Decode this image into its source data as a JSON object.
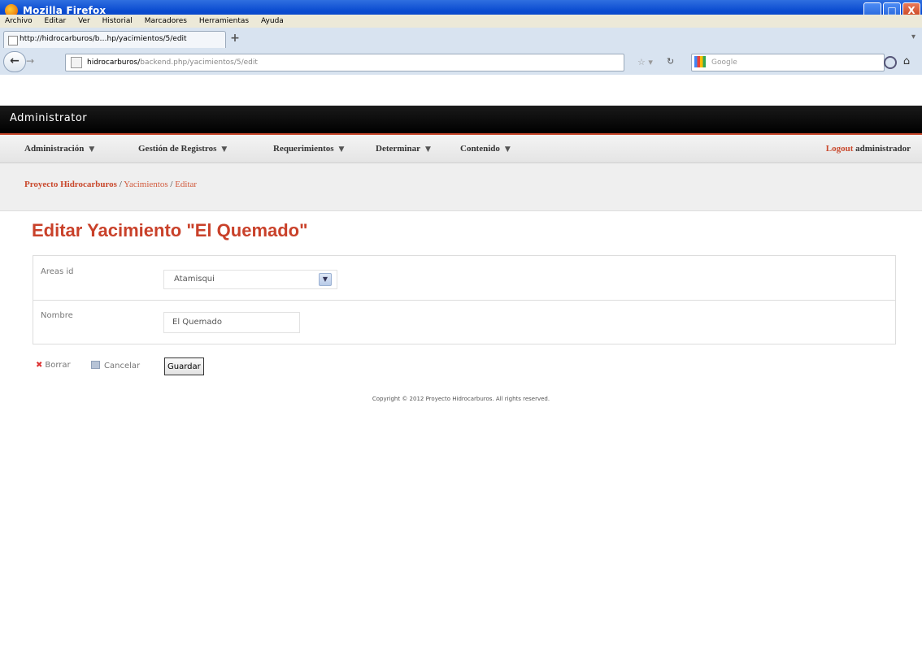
{
  "window": {
    "title": "Mozilla Firefox",
    "buttons": {
      "minimize": "_",
      "maximize": "□",
      "close": "X"
    }
  },
  "menubar": [
    "Archivo",
    "Editar",
    "Ver",
    "Historial",
    "Marcadores",
    "Herramientas",
    "Ayuda"
  ],
  "tab": {
    "label": "http://hidrocarburos/b…hp/yacimientos/5/edit",
    "new_tab": "+"
  },
  "navbar": {
    "url_host": "hidrocarburos/",
    "url_path": "backend.php/yacimientos/5/edit",
    "search_placeholder": "Google"
  },
  "app": {
    "title": "Administrator"
  },
  "mainnav": {
    "items": [
      "Administración",
      "Gestión de Registros",
      "Requerimientos",
      "Determinar",
      "Contenido"
    ],
    "logout_label": "Logout",
    "user": "administrador"
  },
  "breadcrumb": {
    "home": "Proyecto Hidrocarburos",
    "separator": "/",
    "section": "Yacimientos",
    "current": "Editar"
  },
  "page": {
    "title": "Editar Yacimiento \"El Quemado\""
  },
  "form": {
    "areas_label": "Areas id",
    "areas_value": "Atamisqui",
    "nombre_label": "Nombre",
    "nombre_value": "El Quemado"
  },
  "actions": {
    "delete": "Borrar",
    "cancel": "Cancelar",
    "save": "Guardar"
  },
  "footer": {
    "text": "Copyright © 2012 Proyecto Hidrocarburos. All rights reserved."
  },
  "colors": {
    "accent": "#c9412a",
    "header_bg": "#000000",
    "titlebar": "#0a4bd0"
  }
}
